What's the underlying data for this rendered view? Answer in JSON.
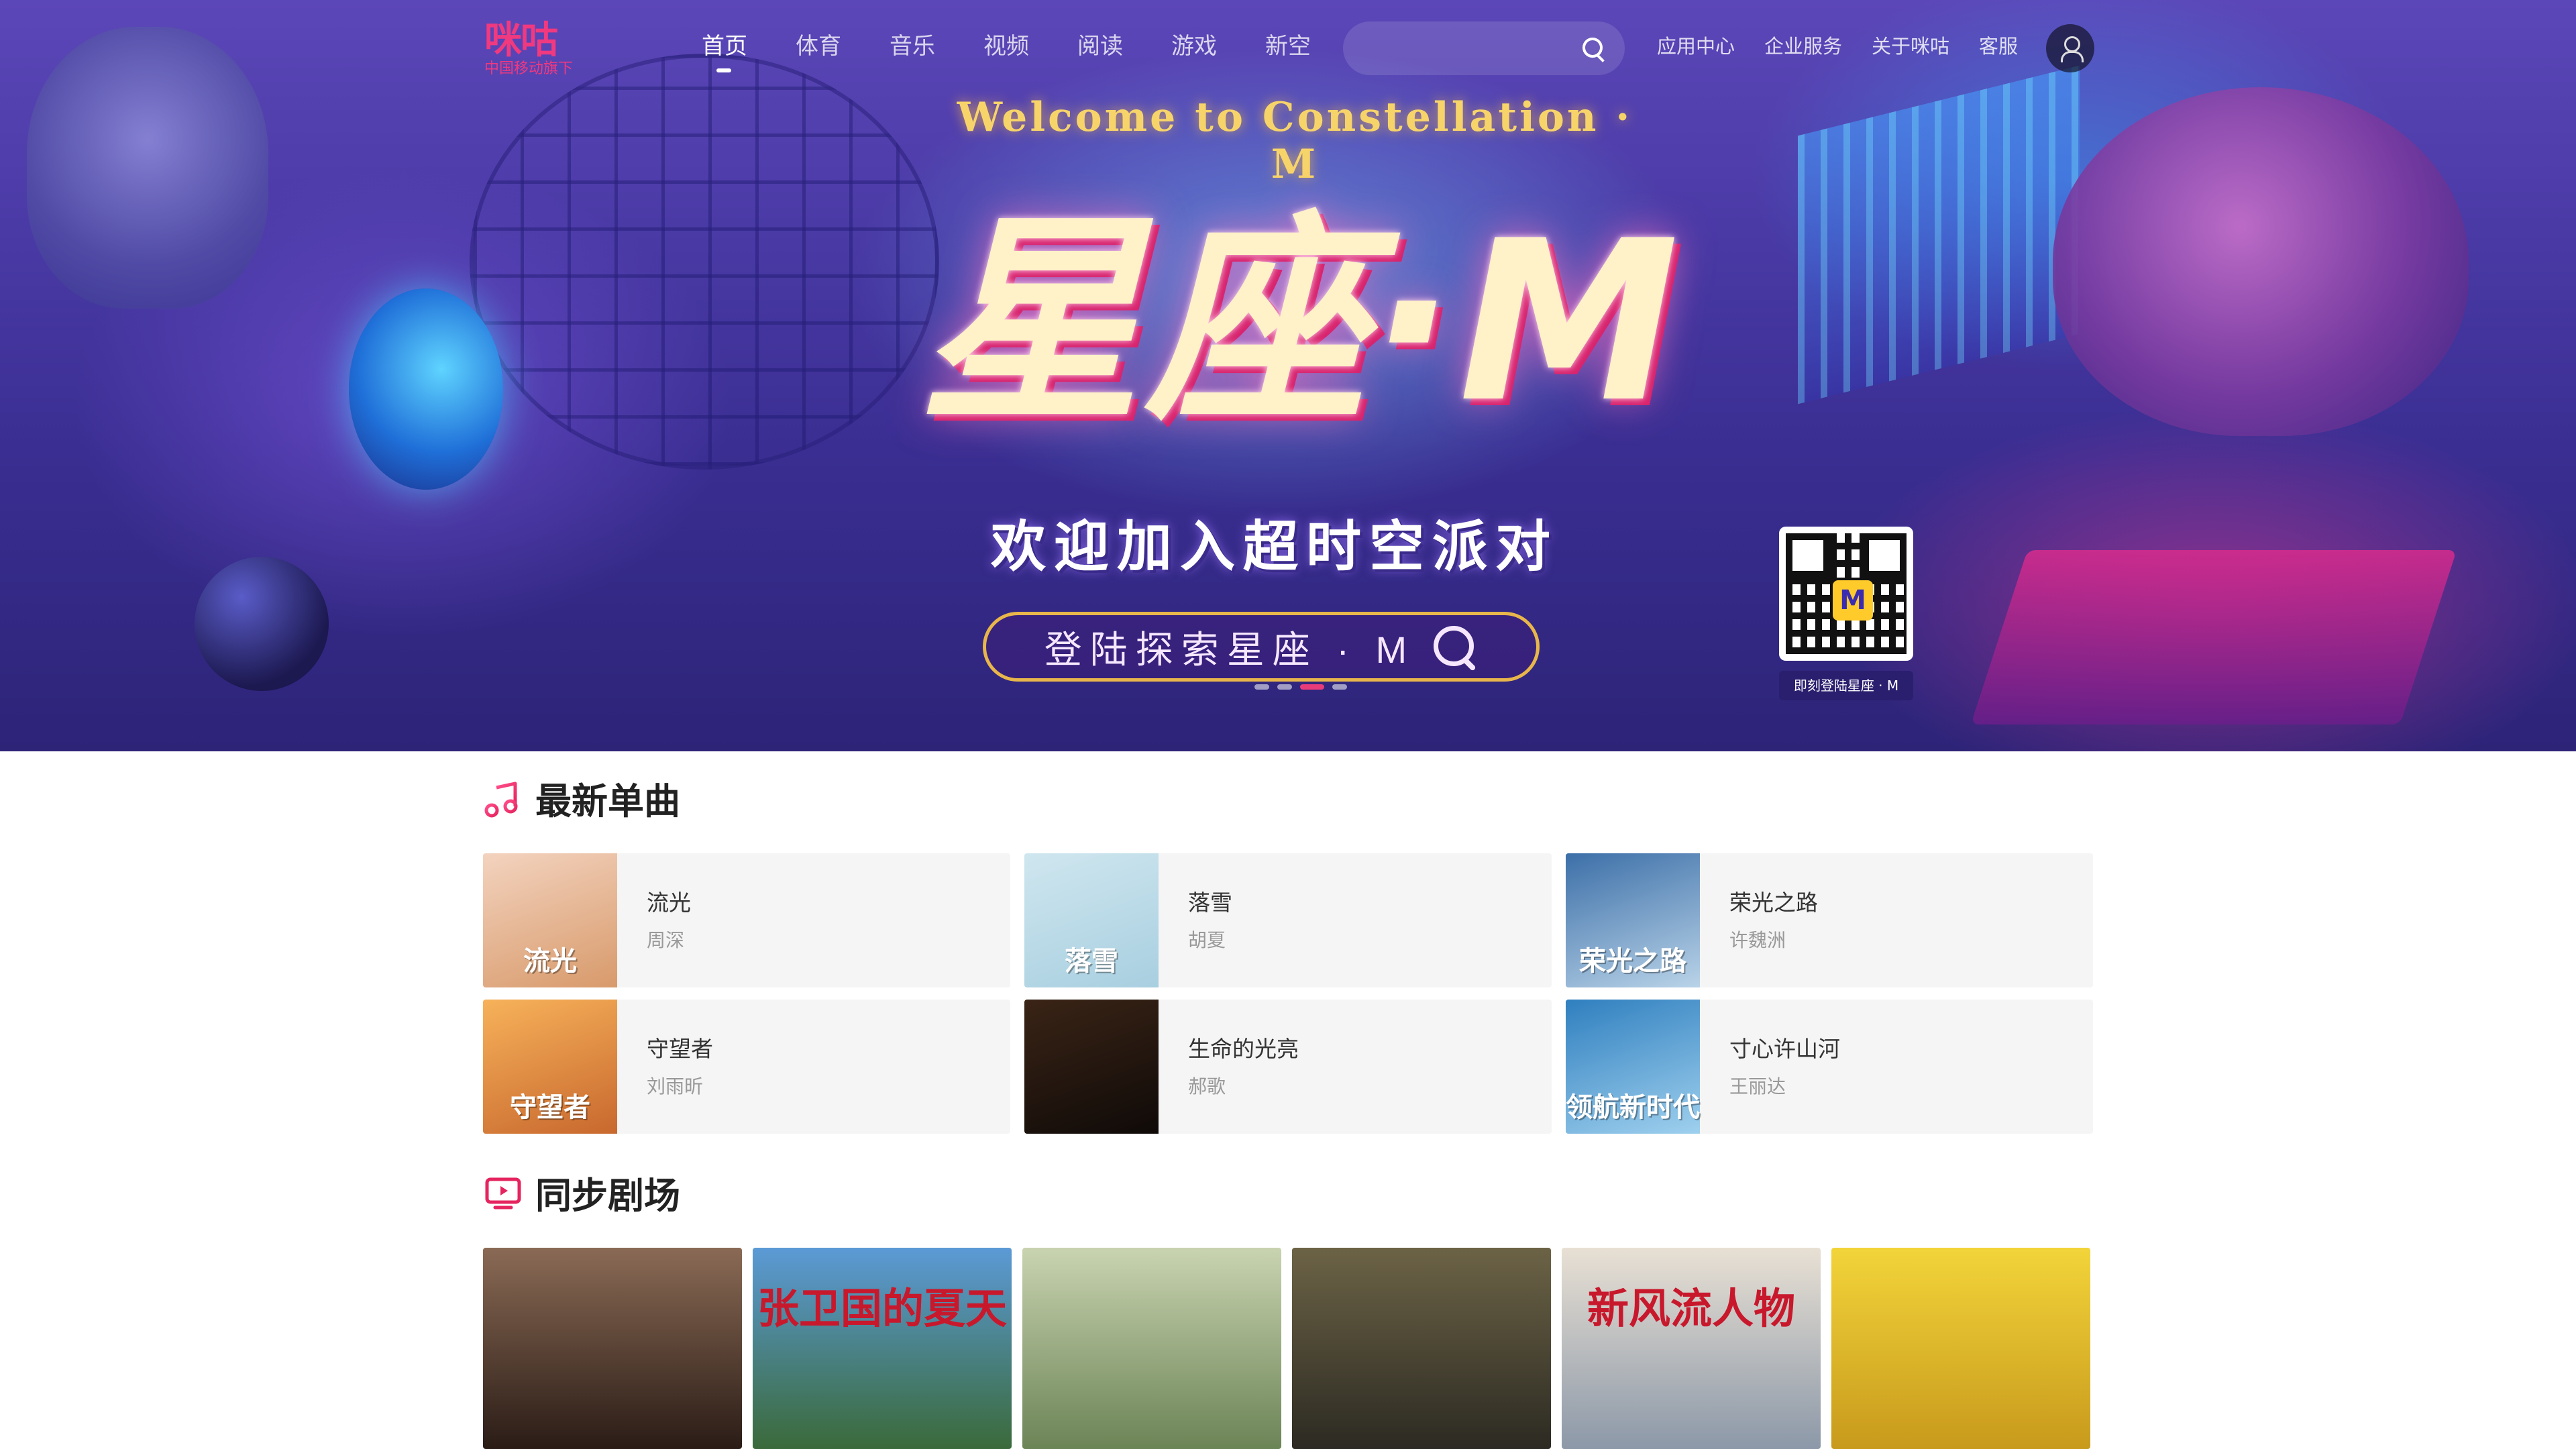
{
  "nav": {
    "logo_text": "咪咕",
    "logo_tagline": "中国移动旗下",
    "links": [
      "首页",
      "体育",
      "音乐",
      "视频",
      "阅读",
      "游戏",
      "新空"
    ],
    "active_index": 0,
    "search_placeholder": "",
    "util_links": [
      "应用中心",
      "企业服务",
      "关于咪咕",
      "客服"
    ]
  },
  "hero": {
    "welcome": "Welcome to Constellation · M",
    "title": "星座·M",
    "subtitle": "欢迎加入超时空派对",
    "cta": "登陆探索星座 · M",
    "qr_caption": "即刻登陆星座 · M",
    "qr_logo": "M",
    "dots": 4,
    "active_dot": 2
  },
  "songs": {
    "title": "最新单曲",
    "items": [
      {
        "name": "流光",
        "artist": "周深",
        "cover_text": "流光",
        "cover_colors": [
          "#f3d3bf",
          "#d89a6b"
        ]
      },
      {
        "name": "落雪",
        "artist": "胡夏",
        "cover_text": "落雪",
        "cover_colors": [
          "#cfe6ef",
          "#a8cfe0"
        ]
      },
      {
        "name": "荣光之路",
        "artist": "许魏洲",
        "cover_text": "荣光之路",
        "cover_colors": [
          "#3c6fa8",
          "#b9d3e8"
        ]
      },
      {
        "name": "守望者",
        "artist": "刘雨昕",
        "cover_text": "守望者",
        "cover_colors": [
          "#f7b25a",
          "#c8682e"
        ]
      },
      {
        "name": "生命的光亮",
        "artist": "郝歌",
        "cover_text": "",
        "cover_colors": [
          "#3a2416",
          "#0f0a08"
        ]
      },
      {
        "name": "寸心许山河",
        "artist": "王丽达",
        "cover_text": "领航新时代",
        "cover_colors": [
          "#2f7fbf",
          "#9fd0ee"
        ]
      }
    ]
  },
  "drama": {
    "title": "同步剧场",
    "items": [
      {
        "poster_title": "",
        "colors": [
          "#8a6a55",
          "#2a1c16"
        ]
      },
      {
        "poster_title": "张卫国的夏天",
        "colors": [
          "#5b9ad6",
          "#3a6a3a"
        ]
      },
      {
        "poster_title": "",
        "colors": [
          "#c9d3b0",
          "#6b8456"
        ]
      },
      {
        "poster_title": "",
        "colors": [
          "#6c6346",
          "#2c2a22"
        ]
      },
      {
        "poster_title": "新风流人物",
        "colors": [
          "#e8e0d4",
          "#8c98a8"
        ]
      },
      {
        "poster_title": "",
        "colors": [
          "#f2d43a",
          "#c89a1c"
        ]
      }
    ]
  }
}
